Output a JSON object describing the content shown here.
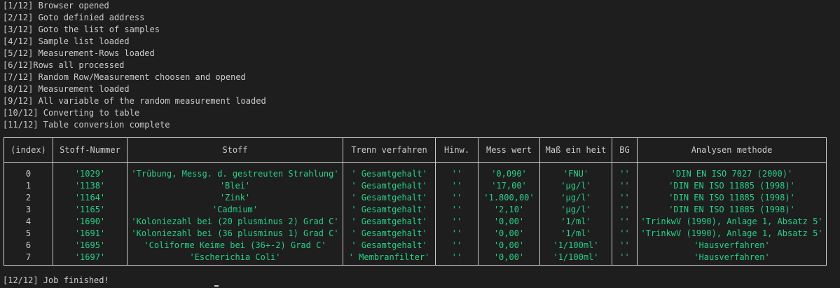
{
  "log": [
    "[1/12] Browser opened",
    "[2/12] Goto definied address",
    "[3/12] Goto the list of samples",
    "[4/12] Sample list loaded",
    "[5/12] Measurement-Rows loaded",
    "[6/12]Rows all processed",
    "[7/12] Random Row/Measurement choosen and opened",
    "[8/12] Measurement loaded",
    "[9/12] All variable of the random measurement loaded",
    "[10/12] Converting to table",
    "[11/12] Table conversion complete"
  ],
  "final_line": "[12/12] Job finished!",
  "colors": {
    "background": "#1e1e1e",
    "text": "#cccccc",
    "value": "#23d18b"
  },
  "table": {
    "headers": [
      "(index)",
      "Stoff-Nummer",
      "Stoff",
      "Trenn verfahren",
      "Hinw.",
      "Mess wert",
      "Maß ein heit",
      "BG",
      "Analysen methode"
    ],
    "rows": [
      [
        "0",
        "'1029'",
        "'Trübung, Messg. d. gestreuten Strahlung'",
        "' Gesamtgehalt'",
        "''",
        "'0,090'",
        "'FNU'",
        "''",
        "'DIN EN ISO 7027 (2000)'"
      ],
      [
        "1",
        "'1138'",
        "'Blei'",
        "' Gesamtgehalt'",
        "''",
        "'17,00'",
        "'µg/l'",
        "''",
        "'DIN EN ISO 11885 (1998)'"
      ],
      [
        "2",
        "'1164'",
        "'Zink'",
        "' Gesamtgehalt'",
        "''",
        "'1.800,00'",
        "'µg/l'",
        "''",
        "'DIN EN ISO 11885 (1998)'"
      ],
      [
        "3",
        "'1165'",
        "'Cadmium'",
        "' Gesamtgehalt'",
        "''",
        "'2,10'",
        "'µg/l'",
        "''",
        "'DIN EN ISO 11885 (1998)'"
      ],
      [
        "4",
        "'1690'",
        "'Koloniezahl bei (20 plusminus 2) Grad C'",
        "' Gesamtgehalt'",
        "''",
        "'0,00'",
        "'1/ml'",
        "''",
        "'TrinkwV (1990), Anlage 1, Absatz 5'"
      ],
      [
        "5",
        "'1691'",
        "'Koloniezahl bei (36 plusminus 1) Grad C'",
        "' Gesamtgehalt'",
        "''",
        "'0,00'",
        "'1/ml'",
        "''",
        "'TrinkwV (1990), Anlage 1, Absatz 5'"
      ],
      [
        "6",
        "'1695'",
        "'Coliforme Keime bei (36+-2) Grad C'",
        "' Gesamtgehalt'",
        "''",
        "'0,00'",
        "'1/100ml'",
        "''",
        "'Hausverfahren'"
      ],
      [
        "7",
        "'1697'",
        "'Escherichia Coli'",
        "' Membranfilter'",
        "''",
        "'0,00'",
        "'1/100ml'",
        "''",
        "'Hausverfahren'"
      ]
    ]
  }
}
